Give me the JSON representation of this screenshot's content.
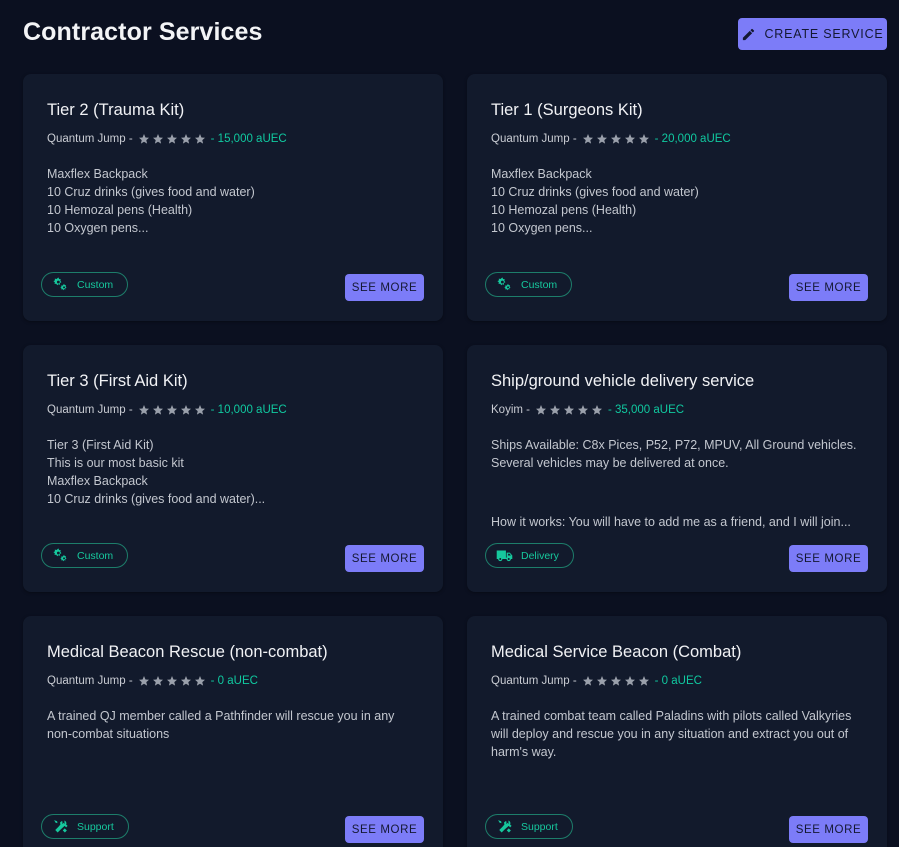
{
  "header": {
    "title": "Contractor Services",
    "create_label": "CREATE SERVICE"
  },
  "colors": {
    "background": "#0b1020",
    "card": "#121a2c",
    "accent": "#7c7cf8",
    "price": "#10c9a0",
    "badge": "#16c89d"
  },
  "cards": [
    {
      "title": "Tier 2 (Trauma Kit)",
      "org": "Quantum Jump -",
      "rating": 5,
      "price": "- 15,000 aUEC",
      "desc": [
        "Maxflex Backpack",
        "10 Cruz drinks (gives food and water)",
        "10 Hemozal pens (Health)",
        "10 Oxygen pens..."
      ],
      "badge": "Custom",
      "badge_icon": "gears-icon",
      "button": "SEE MORE"
    },
    {
      "title": "Tier 1 (Surgeons Kit)",
      "org": "Quantum Jump -",
      "rating": 5,
      "price": "- 20,000 aUEC",
      "desc": [
        "Maxflex Backpack",
        "10 Cruz drinks (gives food and water)",
        "10 Hemozal pens (Health)",
        "10 Oxygen pens..."
      ],
      "badge": "Custom",
      "badge_icon": "gears-icon",
      "button": "SEE MORE"
    },
    {
      "title": "Tier 3 (First Aid Kit)",
      "org": "Quantum Jump -",
      "rating": 5,
      "price": "- 10,000 aUEC",
      "desc": [
        "Tier 3 (First Aid Kit)",
        "This is our most basic kit",
        "Maxflex Backpack",
        "10 Cruz drinks (gives food and water)..."
      ],
      "badge": "Custom",
      "badge_icon": "gears-icon",
      "button": "SEE MORE"
    },
    {
      "title": "Ship/ground vehicle delivery service",
      "org": "Koyim -",
      "rating": 5,
      "price": "- 35,000 aUEC",
      "desc": [
        "Ships Available: C8x Pices, P52, P72, MPUV, All Ground vehicles.",
        "Several vehicles may be delivered at once."
      ],
      "desc_extra": "How it works: You will have to add me as a friend, and I will join...",
      "badge": "Delivery",
      "badge_icon": "truck-icon",
      "button": "SEE MORE"
    },
    {
      "title": "Medical Beacon Rescue (non-combat)",
      "org": "Quantum Jump -",
      "rating": 5,
      "price": "- 0 aUEC",
      "desc": [
        "A trained QJ member called a Pathfinder will rescue you in any",
        "non-combat situations"
      ],
      "badge": "Support",
      "badge_icon": "tools-icon",
      "button": "SEE MORE"
    },
    {
      "title": "Medical Service Beacon (Combat)",
      "org": "Quantum Jump -",
      "rating": 5,
      "price": "- 0 aUEC",
      "desc": [
        "A trained combat team called Paladins with pilots called Valkyries",
        "will deploy and rescue you in any situation and extract you out of",
        "harm's way."
      ],
      "badge": "Support",
      "badge_icon": "tools-icon",
      "button": "SEE MORE"
    }
  ]
}
